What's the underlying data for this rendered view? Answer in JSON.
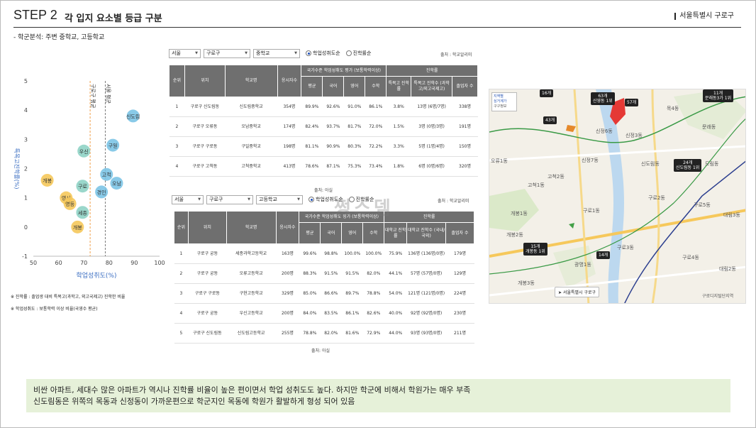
{
  "header": {
    "step": "STEP 2",
    "title": "각 입지 요소별 등급 구분",
    "region": "서울특별시 구로구"
  },
  "subtitle": "- 학군분석: 주변 중학교, 고등학교",
  "scatter": {
    "xlabel": "학업성취도(%)",
    "ylabel": "특목고진학률(%)",
    "line_labels": [
      "구로구 평균",
      "서울 평균"
    ],
    "notes": [
      "※ 진학률 : 졸업생 대비 특목고(과학고, 외고국제고) 진학한 비율",
      "※ 학업성취도 : 보통학력 이상 비율(국영수 평균)"
    ]
  },
  "chart_data": {
    "type": "scatter",
    "xlabel": "학업성취도(%)",
    "ylabel": "특목고진학률(%)",
    "xlim": [
      50,
      100
    ],
    "ylim": [
      -1,
      5
    ],
    "xticks": [
      50,
      60,
      70,
      80,
      90,
      100
    ],
    "yticks": [
      -1,
      0,
      1,
      2,
      3,
      4,
      5
    ],
    "vlines": [
      {
        "x": 72.5,
        "label": "구로구 평균",
        "color": "#f0a04b"
      },
      {
        "x": 78.5,
        "label": "서울 평균",
        "color": "#7a7a7a"
      }
    ],
    "points": [
      {
        "label": "신도림",
        "x": 89.5,
        "y": 3.8,
        "color": "#7cc4e6"
      },
      {
        "label": "구일",
        "x": 81.5,
        "y": 2.8,
        "color": "#7cc4e6"
      },
      {
        "label": "우신",
        "x": 70,
        "y": 2.6,
        "color": "#8fd3c5"
      },
      {
        "label": "고척",
        "x": 79,
        "y": 1.8,
        "color": "#7cc4e6"
      },
      {
        "label": "오남",
        "x": 83,
        "y": 1.5,
        "color": "#7cc4e6"
      },
      {
        "label": "개봉",
        "x": 55.5,
        "y": 1.6,
        "color": "#f5c85b"
      },
      {
        "label": "구로",
        "x": 69.5,
        "y": 1.4,
        "color": "#8fd3c5"
      },
      {
        "label": "경인",
        "x": 77,
        "y": 1.2,
        "color": "#7cc4e6"
      },
      {
        "label": "영서",
        "x": 63,
        "y": 1.0,
        "color": "#f5c85b"
      },
      {
        "label": "영등",
        "x": 64.5,
        "y": 0.8,
        "color": "#f5c85b"
      },
      {
        "label": "세종",
        "x": 69.5,
        "y": 0.5,
        "color": "#8fd3c5"
      },
      {
        "label": "개봉",
        "x": 67.5,
        "y": 0.0,
        "color": "#f5c85b"
      }
    ]
  },
  "middle": {
    "filters": {
      "city": "서울",
      "district": "구로구",
      "level": "중학교",
      "radio1": "학업성취도순",
      "radio2": "진학률순"
    },
    "source_top": "출처 : 학교알리미",
    "header_group1": "국가수준 학업성취도 평가 (보통학력이상)",
    "header_group2": "진학률",
    "cols": [
      "순위",
      "위치",
      "학교명",
      "응시자수",
      "평균",
      "국어",
      "영어",
      "수학",
      "특목고 진학률",
      "특목고 진학수 (과학고/외고국제고)",
      "졸업자 수"
    ],
    "rows": [
      [
        "1",
        "구로구 신도림동",
        "신도림중학교",
        "354명",
        "89.9%",
        "92.6%",
        "91.0%",
        "86.1%",
        "3.8%",
        "13명 (6명/7명)",
        "338명"
      ],
      [
        "2",
        "구로구 오류동",
        "오남중학교",
        "174명",
        "82.4%",
        "93.7%",
        "81.7%",
        "72.0%",
        "1.5%",
        "3명 (0명/3명)",
        "191명"
      ],
      [
        "3",
        "구로구 구로동",
        "구일중학교",
        "198명",
        "81.1%",
        "90.9%",
        "80.3%",
        "72.2%",
        "3.3%",
        "5명 (1명/4명)",
        "150명"
      ],
      [
        "4",
        "구로구 고척동",
        "고척중학교",
        "413명",
        "78.6%",
        "87.1%",
        "75.3%",
        "73.4%",
        "1.8%",
        "6명 (0명/6명)",
        "320명"
      ]
    ],
    "source_bottom": "출처: 아실"
  },
  "high": {
    "filters": {
      "city": "서울",
      "district": "구로구",
      "level": "고등학교",
      "radio1": "학업성취도순",
      "radio2": "진학률순"
    },
    "source_top": "출처 : 학교알리미",
    "header_group1": "국가수준 학업성취도 평가 (보통학력이상)",
    "header_group2": "진학률",
    "cols": [
      "순위",
      "위치",
      "학교명",
      "응시자수",
      "평균",
      "국어",
      "영어",
      "수학",
      "대학교 진학률",
      "대학교 진학수 (국내/국외)",
      "졸업자 수"
    ],
    "rows": [
      [
        "1",
        "구로구 궁동",
        "세종과학고등학교",
        "163명",
        "99.6%",
        "98.8%",
        "100.0%",
        "100.0%",
        "75.9%",
        "136명 (136명/0명)",
        "179명"
      ],
      [
        "2",
        "구로구 궁동",
        "오류고등학교",
        "200명",
        "88.3%",
        "91.5%",
        "91.5%",
        "82.0%",
        "44.1%",
        "57명 (57명/0명)",
        "129명"
      ],
      [
        "3",
        "구로구 구로동",
        "구현고등학교",
        "329명",
        "85.0%",
        "86.6%",
        "89.7%",
        "78.8%",
        "54.0%",
        "121명 (121명/0명)",
        "224명"
      ],
      [
        "4",
        "구로구 궁동",
        "우신고등학교",
        "200명",
        "84.0%",
        "83.5%",
        "86.1%",
        "82.6%",
        "40.0%",
        "92명 (92명/0명)",
        "230명"
      ],
      [
        "5",
        "구로구 신도림동",
        "신도림고등학교",
        "255명",
        "78.8%",
        "82.0%",
        "81.6%",
        "72.9%",
        "44.0%",
        "93명 (93명/0명)",
        "211명"
      ]
    ],
    "source_bottom": "출처: 아실"
  },
  "watermark": "쩡스뎀",
  "map": {
    "control": [
      "지역별",
      "싱거계가",
      "구구정보"
    ],
    "location_button": "서울특별시 구로구",
    "badges": [
      {
        "count": "16개",
        "sub": ""
      },
      {
        "count": "63개",
        "sub": "신영동 1위"
      },
      {
        "count": "57개",
        "sub": ""
      },
      {
        "count": "11개",
        "sub": "문래동3가 1위"
      },
      {
        "count": "43개",
        "sub": ""
      },
      {
        "count": "24개",
        "sub": "신도림동 1위"
      },
      {
        "count": "15개",
        "sub": "개봉동 1위"
      },
      {
        "count": "14개",
        "sub": ""
      }
    ],
    "labels": [
      "신정6동",
      "신정7동",
      "신도림동",
      "도림동",
      "문래동",
      "고척2동",
      "고척1동",
      "개봉1동",
      "개봉2동",
      "구로2동",
      "구로4동",
      "구로5동",
      "구로1동",
      "구로3동",
      "대림3동",
      "대림2동",
      "광명1동",
      "개봉3동",
      "신정3동",
      "목4동",
      "오류1동",
      "구로디지털단지역"
    ]
  },
  "summary": {
    "line1": "비싼 아파트, 세대수 많은 아파트가 역시나 진학률 비율이 높은 편이면서 학업 성취도도 높다. 하지만 학군에 비해서 학원가는 매우 부족",
    "line2": "신도림동은 위쪽의 목동과 신정동이 가까운편으로 학군지인 목동에 학원가 활발하게 형성 되어 있음"
  }
}
